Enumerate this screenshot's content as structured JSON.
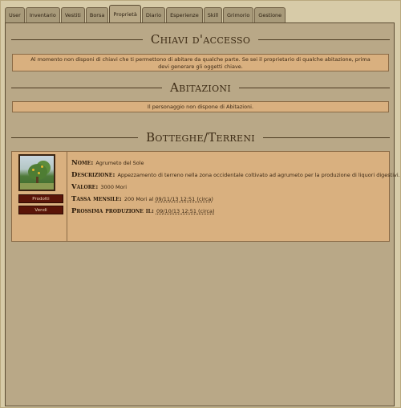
{
  "tabs": [
    {
      "label": "User",
      "active": false
    },
    {
      "label": "Inventario",
      "active": false
    },
    {
      "label": "Vestiti",
      "active": false
    },
    {
      "label": "Borsa",
      "active": false
    },
    {
      "label": "Proprietà",
      "active": true
    },
    {
      "label": "Diario",
      "active": false
    },
    {
      "label": "Esperienze",
      "active": false
    },
    {
      "label": "Skill",
      "active": false
    },
    {
      "label": "Grimorio",
      "active": false
    },
    {
      "label": "Gestione",
      "active": false
    }
  ],
  "sections": {
    "keys": {
      "title": "Chiavi d'accesso",
      "notice": "Al momento non disponi di chiavi che ti permettono di abitare da qualche parte. Se sei il proprietario di qualche abitazione, prima devi generare gli oggetti chiave."
    },
    "homes": {
      "title": "Abitazioni",
      "notice": "Il personaggio non dispone di Abitazioni."
    },
    "shops": {
      "title": "Botteghe/Terreni"
    }
  },
  "shop": {
    "photo_alt": "orange-tree-photo",
    "products_button": "Prodotti",
    "sell_button": "Vendi",
    "name_label": "Nome:",
    "name_value": "Agrumeto del Sole",
    "description_label": "Descrizione:",
    "description_value": "Appezzamento di terreno nella zona occidentale coltivato ad agrumeto per la produzione di liquori digestivi.",
    "value_label": "Valore:",
    "value_value": "3000 Mori",
    "tax_label": "Tassa mensile:",
    "tax_amount": "200 Mori al",
    "tax_date": "09/11/13 12:51 (circa)",
    "production_label": "Prossima produzione il:",
    "production_date": "09/10/13 12:51 (circa)"
  }
}
